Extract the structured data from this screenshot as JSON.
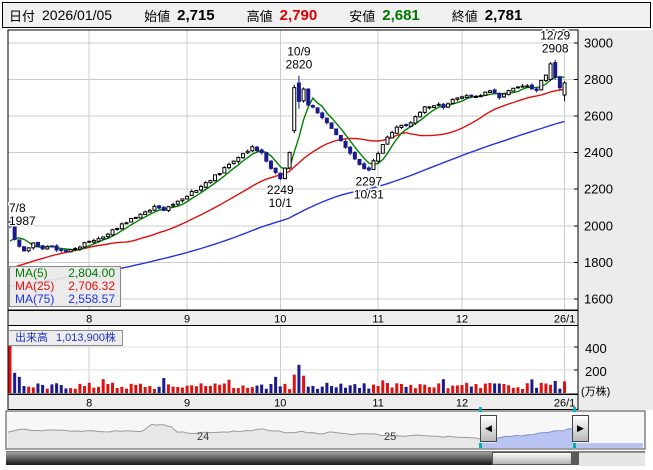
{
  "header": {
    "date_label": "日付",
    "date_value": "2026/01/05",
    "fields": [
      {
        "label": "始値",
        "value": "2,715",
        "color": "#000000"
      },
      {
        "label": "高値",
        "value": "2,790",
        "color": "#dd0000"
      },
      {
        "label": "安値",
        "value": "2,681",
        "color": "#007700"
      },
      {
        "label": "終値",
        "value": "2,781",
        "color": "#000000"
      }
    ]
  },
  "ma_legend": {
    "rows": [
      {
        "label": "MA(5)",
        "value": "2,804.00",
        "color": "#007a00"
      },
      {
        "label": "MA(25)",
        "value": "2,706.32",
        "color": "#e01010"
      },
      {
        "label": "MA(75)",
        "value": "2,558.57",
        "color": "#2233dd"
      }
    ]
  },
  "volume_panel": {
    "label": "出来高",
    "value": "1,013,900株",
    "ticks": [
      "400",
      "200"
    ],
    "unit": "(万株)"
  },
  "navigator": {
    "prev_icon": "◀",
    "next_icon": "▶"
  },
  "chart_data": {
    "type": "candlestick",
    "y_axis": {
      "ticks": [
        3000,
        2800,
        2600,
        2400,
        2200,
        2000,
        1800,
        1600
      ],
      "min": 1540,
      "max": 3060
    },
    "x_axis": {
      "labels": [
        "8",
        "9",
        "10",
        "11",
        "12",
        "26/1"
      ],
      "label_days": [
        17,
        38,
        58,
        79,
        97,
        119
      ]
    },
    "up_color": "#ffffff",
    "down_color": "#1a1a8e",
    "wick_color": "#000000",
    "volume_up_color": "#e01010",
    "volume_down_color": "#1a1a8e",
    "grid_color": "#cccccc",
    "ma_lines": [
      {
        "name": "MA(5)",
        "period": 5,
        "color": "#008000"
      },
      {
        "name": "MA(25)",
        "period": 25,
        "color": "#e01010"
      },
      {
        "name": "MA(75)",
        "period": 75,
        "color": "#2233dd"
      }
    ],
    "annotations": [
      {
        "day": 0,
        "lines": [
          "7/8",
          "1987"
        ],
        "pos": "left"
      },
      {
        "day": 62,
        "lines": [
          "10/9",
          "2820"
        ],
        "pos": "above"
      },
      {
        "day": 58,
        "lines": [
          "2249",
          "10/1"
        ],
        "pos": "below"
      },
      {
        "day": 77,
        "lines": [
          "2297",
          "10/31"
        ],
        "pos": "below"
      },
      {
        "day": 117,
        "lines": [
          "12/29",
          "2908"
        ],
        "pos": "above"
      }
    ],
    "price_path_anchors": [
      [
        -75,
        1565
      ],
      [
        -60,
        1600
      ],
      [
        -45,
        1630
      ],
      [
        -32,
        1655
      ],
      [
        -22,
        1680
      ],
      [
        -14,
        1715
      ],
      [
        -8,
        1775
      ],
      [
        -4,
        1845
      ],
      [
        -2,
        1905
      ],
      [
        -1,
        1960
      ],
      [
        0,
        1996
      ],
      [
        1,
        1932
      ],
      [
        2,
        1886
      ],
      [
        3,
        1864
      ],
      [
        5,
        1902
      ],
      [
        7,
        1868
      ],
      [
        9,
        1892
      ],
      [
        11,
        1858
      ],
      [
        13,
        1868
      ],
      [
        15,
        1888
      ],
      [
        17,
        1918
      ],
      [
        19,
        1932
      ],
      [
        21,
        1956
      ],
      [
        23,
        1988
      ],
      [
        26,
        2042
      ],
      [
        29,
        2078
      ],
      [
        31,
        2102
      ],
      [
        33,
        2086
      ],
      [
        35,
        2122
      ],
      [
        38,
        2166
      ],
      [
        41,
        2216
      ],
      [
        44,
        2272
      ],
      [
        47,
        2332
      ],
      [
        50,
        2396
      ],
      [
        52,
        2432
      ],
      [
        54,
        2396
      ],
      [
        56,
        2312
      ],
      [
        58,
        2258
      ],
      [
        59,
        2312
      ],
      [
        60,
        2408
      ],
      [
        61,
        2755
      ],
      [
        62,
        2682
      ],
      [
        63,
        2742
      ],
      [
        64,
        2662
      ],
      [
        66,
        2622
      ],
      [
        68,
        2562
      ],
      [
        70,
        2502
      ],
      [
        72,
        2422
      ],
      [
        74,
        2362
      ],
      [
        76,
        2312
      ],
      [
        77,
        2305
      ],
      [
        78,
        2356
      ],
      [
        80,
        2442
      ],
      [
        82,
        2512
      ],
      [
        84,
        2556
      ],
      [
        85,
        2542
      ],
      [
        87,
        2596
      ],
      [
        89,
        2646
      ],
      [
        91,
        2662
      ],
      [
        93,
        2652
      ],
      [
        95,
        2686
      ],
      [
        97,
        2702
      ],
      [
        99,
        2712
      ],
      [
        101,
        2716
      ],
      [
        103,
        2732
      ],
      [
        105,
        2706
      ],
      [
        107,
        2736
      ],
      [
        109,
        2752
      ],
      [
        111,
        2762
      ],
      [
        113,
        2740
      ],
      [
        114,
        2790
      ],
      [
        115,
        2820
      ],
      [
        116,
        2885
      ],
      [
        117,
        2812
      ],
      [
        118,
        2755
      ],
      [
        119,
        2781
      ]
    ],
    "key_days": {
      "0": {
        "open": 2022,
        "high": 2030,
        "low": 1987,
        "close": 1996
      },
      "58": {
        "close": 2258,
        "low": 2249
      },
      "61": {
        "open": 2520,
        "high": 2770,
        "low": 2505,
        "close": 2755
      },
      "62": {
        "open": 2780,
        "high": 2820,
        "low": 2640,
        "close": 2680
      },
      "77": {
        "close": 2305,
        "low": 2297
      },
      "116": {
        "open": 2800,
        "high": 2895,
        "low": 2790,
        "close": 2885
      },
      "117": {
        "open": 2892,
        "high": 2908,
        "low": 2798,
        "close": 2812
      },
      "118": {
        "open": 2812,
        "high": 2820,
        "low": 2742,
        "close": 2755
      },
      "119": {
        "open": 2715,
        "high": 2790,
        "low": 2681,
        "close": 2781
      }
    },
    "volume_overrides": {
      "0": [
        460,
        "up"
      ],
      "1": 175,
      "2": 140,
      "20": 120,
      "33": 130,
      "47": 115,
      "57": 140,
      "61": 160,
      "62": 245,
      "63": 150,
      "80": 110,
      "93": [
        120,
        "down"
      ],
      "112": 118,
      "117": 105,
      "119": [
        101,
        "up"
      ]
    },
    "overview": {
      "labels": [
        "24",
        "25"
      ],
      "selection_start": 0.865,
      "line_color": "#9a9a9a",
      "fill_color": "#e7e7e7",
      "selection_fill": "#b9c4f2",
      "selection_line": "#8392cc",
      "points": [
        [
          0,
          0.42
        ],
        [
          0.02,
          0.52
        ],
        [
          0.05,
          0.48
        ],
        [
          0.08,
          0.5
        ],
        [
          0.11,
          0.45
        ],
        [
          0.14,
          0.47
        ],
        [
          0.17,
          0.43
        ],
        [
          0.2,
          0.45
        ],
        [
          0.235,
          0.44
        ],
        [
          0.255,
          0.72
        ],
        [
          0.275,
          0.7
        ],
        [
          0.29,
          0.62
        ],
        [
          0.3,
          0.42
        ],
        [
          0.33,
          0.36
        ],
        [
          0.36,
          0.4
        ],
        [
          0.39,
          0.42
        ],
        [
          0.42,
          0.48
        ],
        [
          0.45,
          0.55
        ],
        [
          0.47,
          0.46
        ],
        [
          0.5,
          0.4
        ],
        [
          0.52,
          0.45
        ],
        [
          0.55,
          0.35
        ],
        [
          0.575,
          0.42
        ],
        [
          0.61,
          0.32
        ],
        [
          0.64,
          0.35
        ],
        [
          0.67,
          0.29
        ],
        [
          0.7,
          0.26
        ],
        [
          0.73,
          0.3
        ],
        [
          0.76,
          0.26
        ],
        [
          0.79,
          0.23
        ],
        [
          0.82,
          0.2
        ],
        [
          0.845,
          0.16
        ],
        [
          0.865,
          0.18
        ],
        [
          0.89,
          0.25
        ],
        [
          0.92,
          0.32
        ],
        [
          0.95,
          0.4
        ],
        [
          0.975,
          0.47
        ],
        [
          1.0,
          0.55
        ]
      ]
    }
  }
}
